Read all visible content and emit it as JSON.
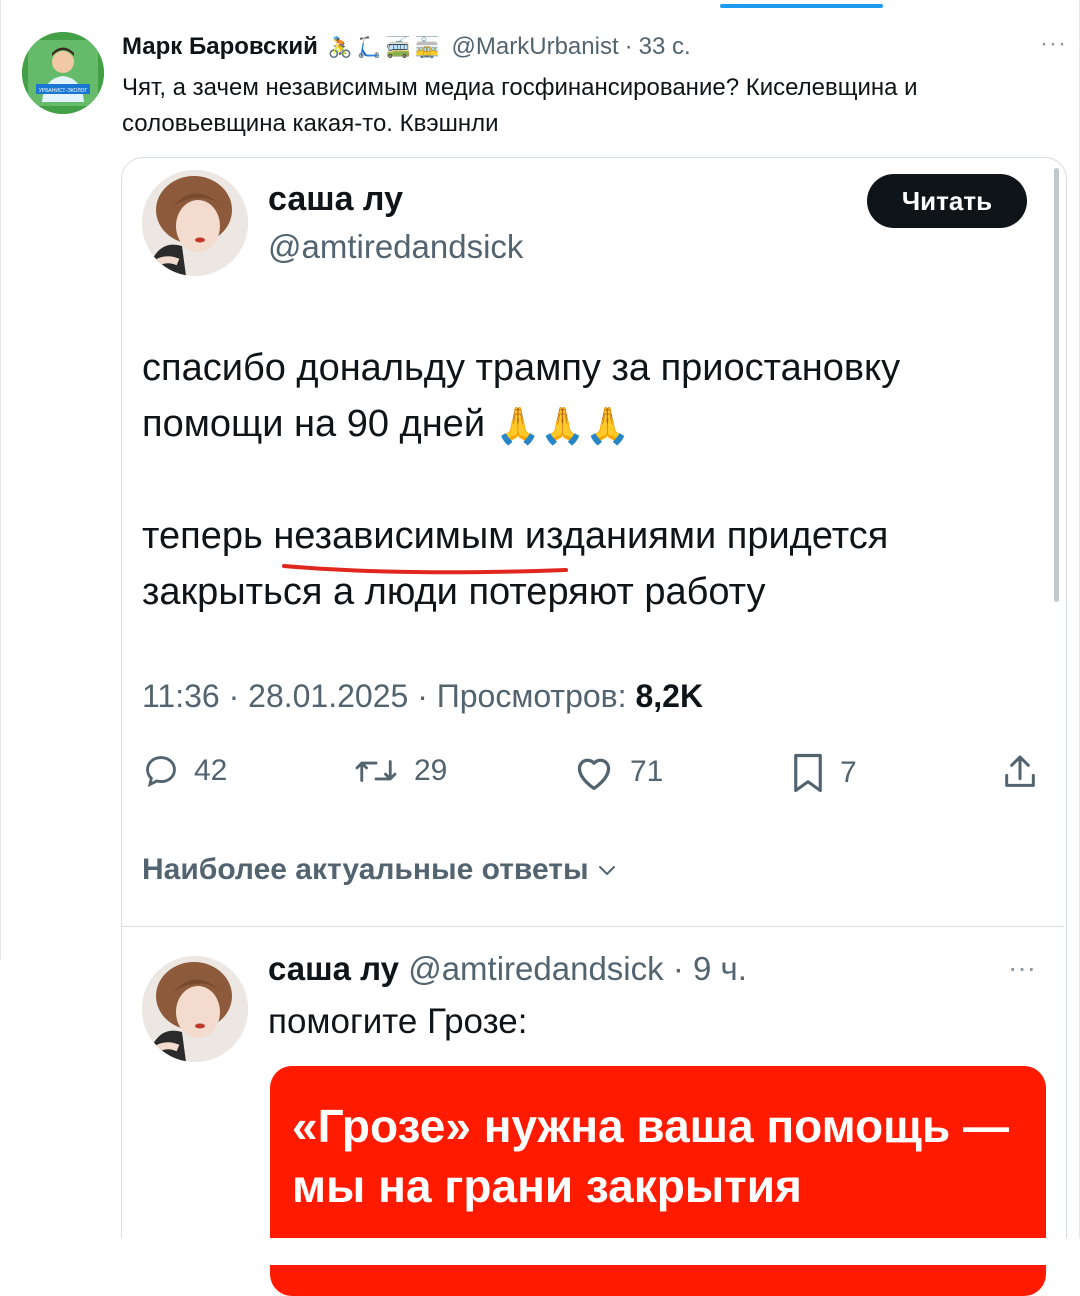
{
  "outer_tweet": {
    "name": "Марк Баровский",
    "emojis": [
      "🚴",
      "🛴",
      "🚎",
      "🚋"
    ],
    "handle": "@MarkUrbanist",
    "time": "33 с.",
    "text": "Чят, а зачем независимым медиа госфинансирование? Киселевщина и соловьевщина какая-то. Квэшнли",
    "avatar_badge": "УРБАНИСТ-ЭКОЛОГ"
  },
  "embedded_tweet": {
    "name": "саша лу",
    "handle": "@amtiredandsick",
    "follow_label": "Читать",
    "text_line1": "спасибо дональду трампу за приостановку",
    "text_line2": "помощи на 90 дней",
    "text_line3_pre": "теперь ",
    "text_line3_underlined": "независимым",
    "text_line3_post": " изданиями придется",
    "text_line4": "закрыться а люди потеряют работу",
    "meta_time": "11:36 · 28.01.2025 · Просмотров: ",
    "meta_views": "8,2K",
    "stats": {
      "replies": "42",
      "retweets": "29",
      "likes": "71",
      "bookmarks": "7"
    },
    "replies_header": "Наиболее актуальные ответы",
    "accent_color": "#e0271f"
  },
  "reply_tweet": {
    "name": "саша лу",
    "handle": "@amtiredandsick",
    "time": "9 ч.",
    "text": "помогите Грозе:",
    "card_text": "«Грозе» нужна ваша помощь — мы на грани закрытия",
    "card_color": "#ff1a00"
  }
}
